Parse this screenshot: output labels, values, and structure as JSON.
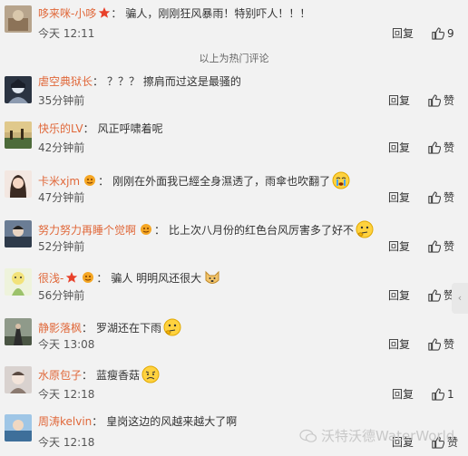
{
  "comments": [
    {
      "user": "哆来咪-小哆",
      "text": "骗人，刚刚狂风暴雨！特别吓人！！！",
      "time": "今天 12:11",
      "reply": "回复",
      "likes": "9"
    },
    {
      "user": "虐空典狱长",
      "text": "？？？ 擦肩而过这是最骚的",
      "time": "35分钟前",
      "reply": "回复",
      "likes": "赞"
    },
    {
      "user": "快乐的LV",
      "text": "风正呼啸着呢",
      "time": "42分钟前",
      "reply": "回复",
      "likes": "赞"
    },
    {
      "user": "卡米xjm",
      "text": "刚刚在外面我已經全身濕透了，雨傘也吹翻了",
      "time": "47分钟前",
      "reply": "回复",
      "likes": "赞"
    },
    {
      "user": "努力努力再睡个觉啊",
      "text": "比上次八月份的红色台风厉害多了好不",
      "time": "52分钟前",
      "reply": "回复",
      "likes": "赞"
    },
    {
      "user": "很浅-",
      "text": "骗人 明明风还很大",
      "time": "56分钟前",
      "reply": "回复",
      "likes": "赞"
    },
    {
      "user": "静影落枫",
      "text": "罗湖还在下雨",
      "time": "今天 13:08",
      "reply": "回复",
      "likes": "赞"
    },
    {
      "user": "水原包子",
      "text": "蓝瘦香菇",
      "time": "今天 12:18",
      "reply": "回复",
      "likes": "1"
    },
    {
      "user": "周涛kelvin",
      "text": "皇岗这边的风越来越大了啊",
      "time": "今天 12:18",
      "reply": "回复",
      "likes": "赞"
    }
  ],
  "separator": "以上为热门评论",
  "watermark": "沃特沃德WaterWorld",
  "side_handle_glyph": "‹",
  "icons": {
    "like": "thumbs-up-icon",
    "badge": "vip-badge-icon"
  }
}
